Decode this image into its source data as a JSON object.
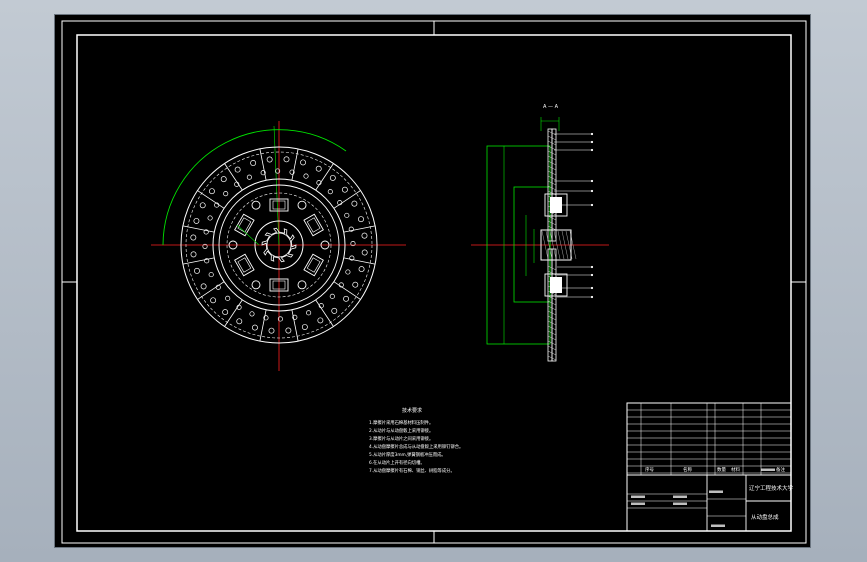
{
  "section_label": "A — A",
  "tech_requirements": {
    "title": "技术要求",
    "items": [
      "1.摩擦片采用石棉基材料压制件。",
      "2.从动片与从动盘毂上采用铆接。",
      "3.摩擦片与从动片之间采用铆接。",
      "4.从动盘摩擦片总成与从动盘毂上采用铆钉铆合。",
      "5.从动片厚度3mm,弹簧钢板冲压而成。",
      "6.在从动片上开有径向切槽。",
      "7.从动盘摩擦片有石棉、铜丝、树脂等成分。"
    ]
  },
  "title_block": {
    "org": "辽宁工程技术大学",
    "drawing_name": "从动盘总成",
    "header_no": "序号",
    "header_name": "名称",
    "header_qty": "数量",
    "header_material": "材料",
    "header_remark": "备注"
  },
  "colors": {
    "background": "#000000",
    "frame": "#ffffff",
    "geometry": "#ffffff",
    "center_lines": "#ff2020",
    "dimensions": "#00e600",
    "hatch": "#d0d0d0",
    "workspace": "#b3bcc7"
  }
}
